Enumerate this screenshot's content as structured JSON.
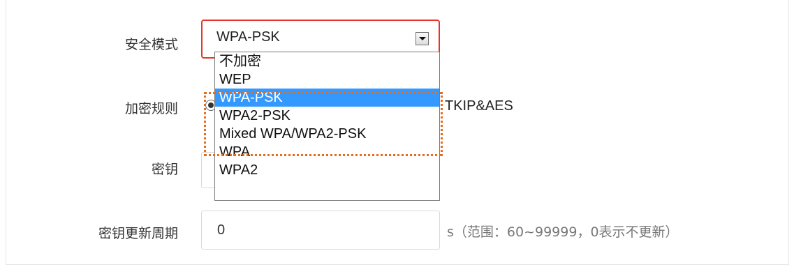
{
  "form": {
    "security_mode_label": "安全模式",
    "encryption_rule_label": "加密规则",
    "key_label": "密钥",
    "key_update_period_label": "密钥更新周期",
    "security_mode_value": "WPA-PSK",
    "encryption_rule_option_text": "TKIP&AES",
    "key_update_period_value": "0",
    "key_update_period_hint": "s（范围：60~99999，0表示不更新）"
  },
  "dropdown": {
    "options": [
      "不加密",
      "WEP",
      "WPA-PSK",
      "WPA2-PSK",
      "Mixed WPA/WPA2-PSK",
      "WPA",
      "WPA2"
    ],
    "selected": "WPA-PSK"
  },
  "colors": {
    "select_border": "#e8342c",
    "highlight_border": "#e86b1a",
    "selected_option_bg": "#3399ff"
  },
  "icons": {
    "dropdown_arrow": "chevron-down-icon"
  }
}
